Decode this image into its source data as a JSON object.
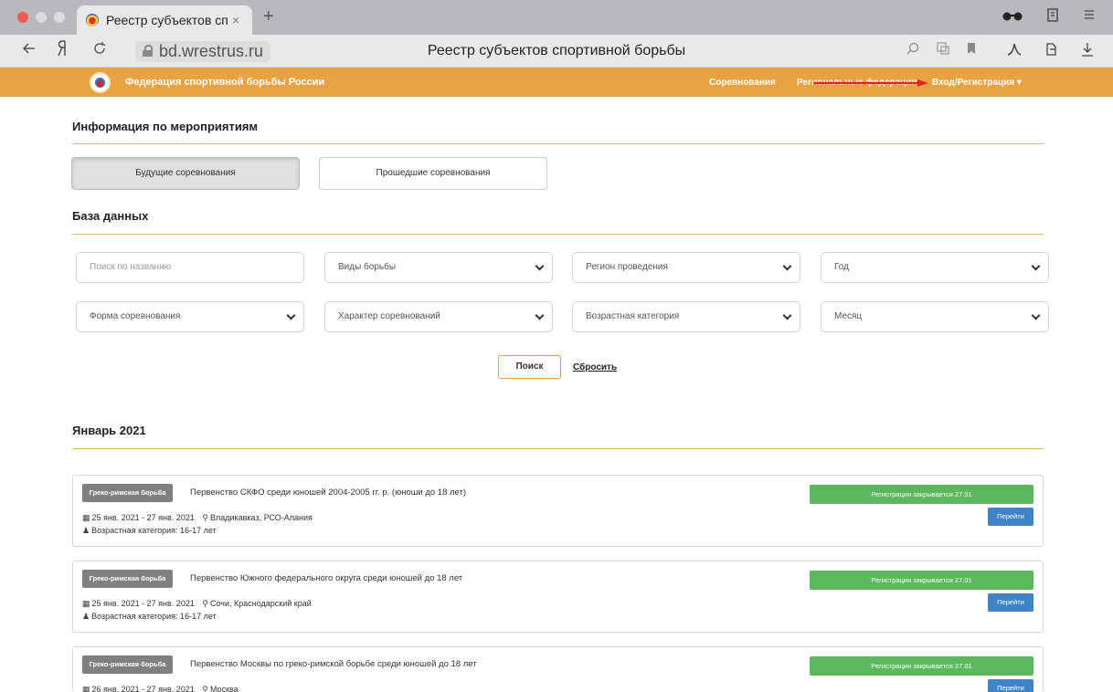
{
  "browser": {
    "tab_title": "Реестр субъектов спо",
    "tab_close": "×",
    "new_tab": "+",
    "url": "bd.wrestrus.ru",
    "page_title": "Реестр субъектов спортивной борьбы"
  },
  "navbar": {
    "brand": "Федерация спортивной борьбы России",
    "links": [
      "Соревнования",
      "Региональные федерации"
    ],
    "login": "Вход/Регистрация ▾",
    "accent_color": "#e8a241"
  },
  "events_section": {
    "title": "Информация по мероприятиям",
    "tabs": [
      "Будущие соревнования",
      "Прошедшие соревнования"
    ]
  },
  "database_section": {
    "title": "База данных",
    "search_placeholder": "Поиск по названию",
    "filters": [
      "Виды борьбы",
      "Регион проведения",
      "Год",
      "Форма соревнования",
      "Характер соревнований",
      "Возрастная категория",
      "Месяц"
    ],
    "search_button": "Поиск",
    "reset_link": "Сбросить"
  },
  "month_section": {
    "title": "Январь 2021"
  },
  "events": [
    {
      "type": "Греко-римская борьба",
      "title": "Первенство СКФО среди юношей 2004-2005 гг. р. (юноши до 18 лет)",
      "dates": "25 янв. 2021 - 27 янв. 2021",
      "location": "Владикавказ, РСО-Алания",
      "age": "Возрастная категория: 16-17 лет",
      "status": "Регистрация закрывается 27.01",
      "action": "Перейти"
    },
    {
      "type": "Греко-римская борьба",
      "title": "Первенство Южного федерального округа среди юношей до 18 лет",
      "dates": "25 янв. 2021 - 27 янв. 2021",
      "location": "Сочи, Краснодарский край",
      "age": "Возрастная категория: 16-17 лет",
      "status": "Регистрация закрывается 27.01",
      "action": "Перейти"
    },
    {
      "type": "Греко-римская борьба",
      "title": "Первенство Москвы по греко-римской борьбе среди юношей до 18 лет",
      "dates": "26 янв. 2021 - 27 янв. 2021",
      "location": "Москва",
      "age": "",
      "status": "Регистрация закрывается 27.01",
      "action": "Перейти"
    }
  ]
}
